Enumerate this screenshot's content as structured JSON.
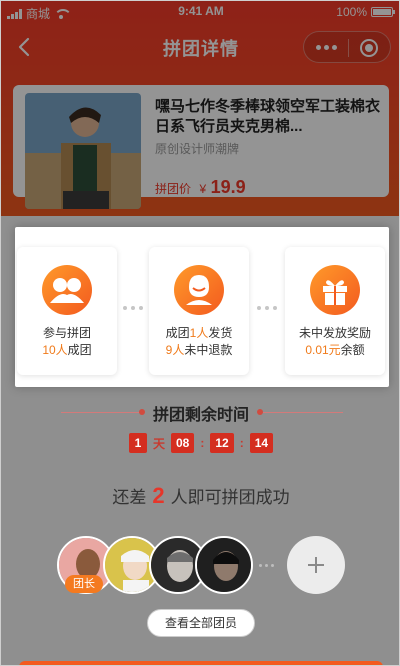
{
  "statusbar": {
    "carrier": "商城",
    "time": "9:41 AM",
    "battery": "100%"
  },
  "navbar": {
    "title": "拼团详情"
  },
  "product": {
    "name": "嘿马七作冬季棒球领空军工装棉衣日系飞行员夹克男棉...",
    "brand": "原创设计师潮牌",
    "price_label": "拼团价",
    "currency": "¥",
    "price": "19.9"
  },
  "steps": [
    {
      "icon": "friends-icon",
      "line1": "参与拼团",
      "line2_highlight": "10人",
      "line2_rest": "成团"
    },
    {
      "icon": "person-icon",
      "line1_prefix": "成团",
      "line1_highlight": "1人",
      "line1_suffix": "发货",
      "line2_highlight": "9人",
      "line2_rest": "未中退款"
    },
    {
      "icon": "gift-icon",
      "line1": "未中发放奖励",
      "line2_highlight": "0.01元",
      "line2_rest": "余额"
    }
  ],
  "countdown": {
    "title": "拼团剩余时间",
    "days": "1",
    "day_unit": "天",
    "hours": "08",
    "minutes": "12",
    "seconds": "14",
    "separator": ":"
  },
  "remain": {
    "prefix": "还差",
    "count": "2",
    "suffix": "人即可拼团成功"
  },
  "members": {
    "leader_badge": "团长",
    "view_all": "查看全部团员"
  },
  "colors": {
    "brand": "#f53a2a",
    "accent": "#f07a1a",
    "countdown": "#d42e20"
  }
}
